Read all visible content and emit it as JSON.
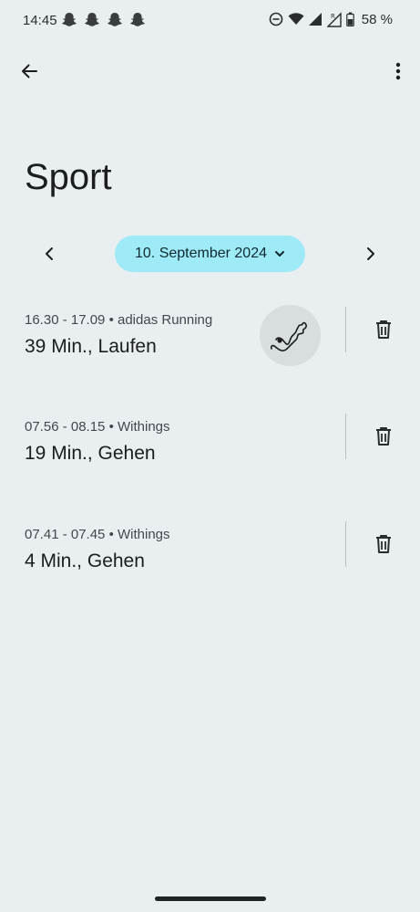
{
  "status_bar": {
    "time": "14:45",
    "battery_text": "58 %",
    "notification_icons": [
      "snapchat-icon",
      "snapchat-icon",
      "snapchat-icon",
      "snapchat-icon"
    ]
  },
  "header": {
    "title": "Sport"
  },
  "date_nav": {
    "date_label": "10. September 2024"
  },
  "activities": [
    {
      "meta": "16.30 - 17.09 • adidas Running",
      "title": "39 Min., Laufen",
      "has_route": true
    },
    {
      "meta": "07.56 - 08.15 • Withings",
      "title": "19 Min., Gehen",
      "has_route": false
    },
    {
      "meta": "07.41 - 07.45 • Withings",
      "title": "4 Min., Gehen",
      "has_route": false
    }
  ],
  "colors": {
    "background": "#e9eef0",
    "date_chip": "#9eeaf7",
    "route_thumb": "#d8dee0"
  }
}
